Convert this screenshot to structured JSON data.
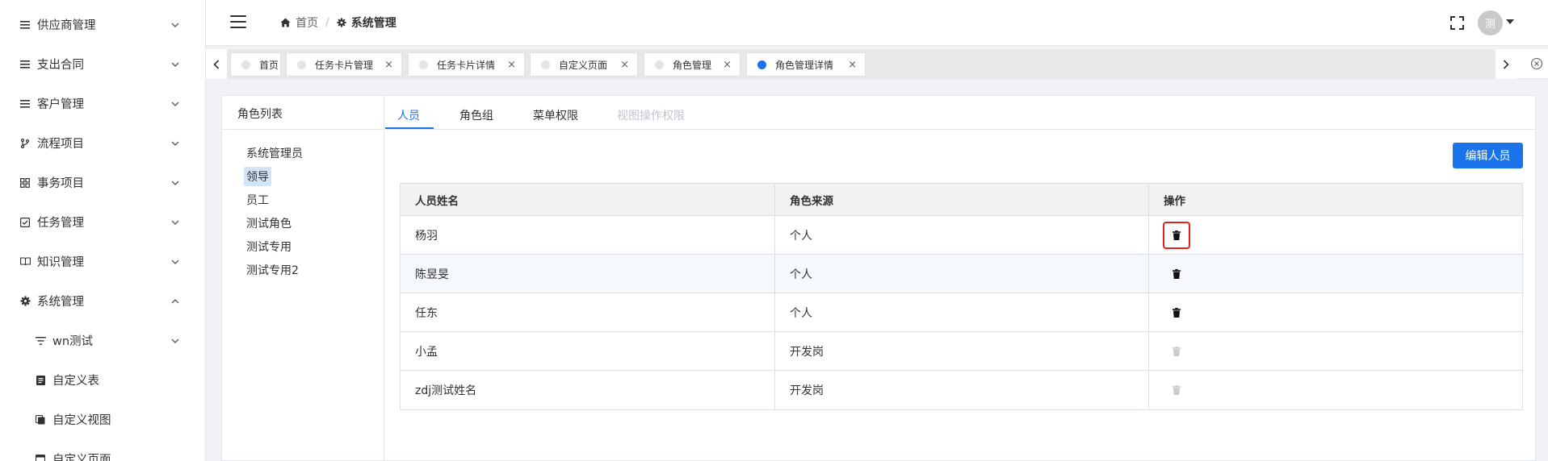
{
  "sidebar": {
    "items": [
      {
        "label": "供应商管理",
        "icon": "list-icon",
        "expanded": false
      },
      {
        "label": "支出合同",
        "icon": "list-icon",
        "expanded": false
      },
      {
        "label": "客户管理",
        "icon": "list-icon",
        "expanded": false
      },
      {
        "label": "流程项目",
        "icon": "branch-icon",
        "expanded": false
      },
      {
        "label": "事务项目",
        "icon": "grid-icon",
        "expanded": false
      },
      {
        "label": "任务管理",
        "icon": "checkbox-icon",
        "expanded": false
      },
      {
        "label": "知识管理",
        "icon": "book-icon",
        "expanded": false
      },
      {
        "label": "系统管理",
        "icon": "gear-icon",
        "expanded": true
      }
    ],
    "subitems": [
      {
        "label": "wn测试",
        "icon": "filter-icon"
      },
      {
        "label": "自定义表",
        "icon": "document-icon"
      },
      {
        "label": "自定义视图",
        "icon": "copy-icon"
      },
      {
        "label": "自定义页面",
        "icon": "window-icon"
      }
    ]
  },
  "header": {
    "breadcrumb_home": "首页",
    "breadcrumb_separator": "/",
    "breadcrumb_current": "系统管理",
    "avatar_text": "测"
  },
  "tabs": [
    {
      "label": "首页",
      "active": false,
      "closable": false
    },
    {
      "label": "任务卡片管理",
      "active": false,
      "closable": true
    },
    {
      "label": "任务卡片详情",
      "active": false,
      "closable": true
    },
    {
      "label": "自定义页面",
      "active": false,
      "closable": true
    },
    {
      "label": "角色管理",
      "active": false,
      "closable": true
    },
    {
      "label": "角色管理详情",
      "active": true,
      "closable": true
    }
  ],
  "tab_close_glyph": "×",
  "role_panel": {
    "title": "角色列表",
    "roles": [
      "系统管理员",
      "领导",
      "员工",
      "测试角色",
      "测试专用",
      "测试专用2"
    ],
    "selected_index": 1
  },
  "detail_tabs": [
    {
      "label": "人员",
      "state": "active"
    },
    {
      "label": "角色组",
      "state": "normal"
    },
    {
      "label": "菜单权限",
      "state": "normal"
    },
    {
      "label": "视图操作权限",
      "state": "disabled"
    }
  ],
  "edit_button_label": "编辑人员",
  "table": {
    "headers": [
      "人员姓名",
      "角色来源",
      "操作"
    ],
    "rows": [
      {
        "name": "杨羽",
        "source": "个人",
        "delete_enabled": true
      },
      {
        "name": "陈昱旻",
        "source": "个人",
        "delete_enabled": true
      },
      {
        "name": "任东",
        "source": "个人",
        "delete_enabled": true
      },
      {
        "name": "小孟",
        "source": "开发岗",
        "delete_enabled": false
      },
      {
        "name": "zdj测试姓名",
        "source": "开发岗",
        "delete_enabled": false
      }
    ]
  },
  "colors": {
    "accent": "#1a73e8",
    "highlight_border": "#e02020",
    "selected_role_bg": "#d4e4f7"
  }
}
